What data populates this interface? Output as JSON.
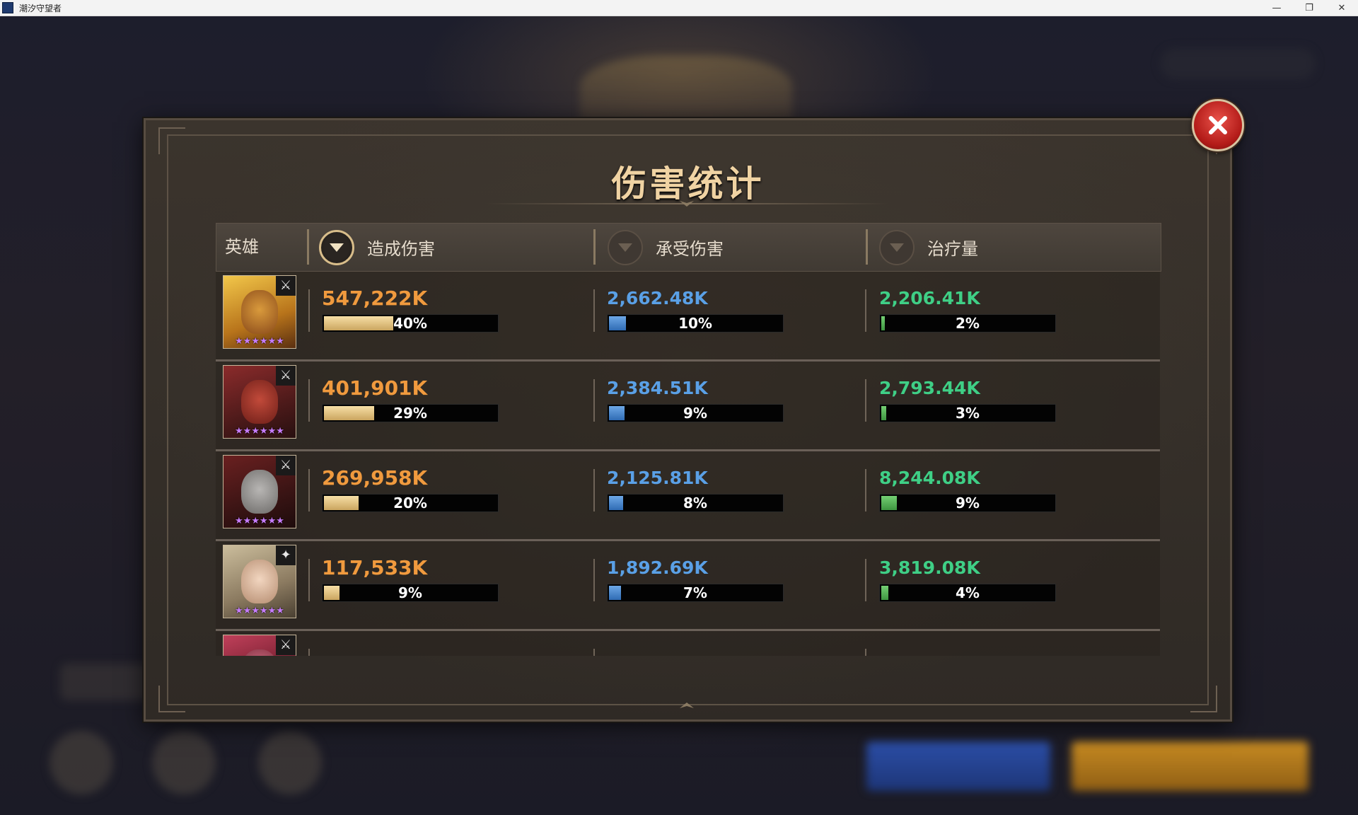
{
  "window": {
    "title": "潮汐守望者",
    "minimize_glyph": "—",
    "restore_glyph": "❐",
    "close_glyph": "✕"
  },
  "panel": {
    "title": "伤害统计"
  },
  "header": {
    "hero": "英雄",
    "columns": [
      {
        "label": "造成伤害",
        "sort_active": true
      },
      {
        "label": "承受伤害",
        "sort_active": false
      },
      {
        "label": "治疗量",
        "sort_active": false
      }
    ]
  },
  "colors": {
    "dealt": "#f09a3e",
    "taken": "#5aa0e6",
    "heal": "#3fcf86",
    "stars": "#c77dff"
  },
  "rows": [
    {
      "hero": "hero-1",
      "stars": "★★★★★★",
      "role_icon": "sword-icon",
      "role_glyph": "⚔",
      "dealt": "547,222K",
      "dealt_pct": "40%",
      "dealt_frac": 0.4,
      "taken": "2,662.48K",
      "taken_pct": "10%",
      "taken_frac": 0.1,
      "heal": "2,206.41K",
      "heal_pct": "2%",
      "heal_frac": 0.02
    },
    {
      "hero": "hero-2",
      "stars": "★★★★★★",
      "role_icon": "sword-icon",
      "role_glyph": "⚔",
      "dealt": "401,901K",
      "dealt_pct": "29%",
      "dealt_frac": 0.29,
      "taken": "2,384.51K",
      "taken_pct": "9%",
      "taken_frac": 0.09,
      "heal": "2,793.44K",
      "heal_pct": "3%",
      "heal_frac": 0.03
    },
    {
      "hero": "hero-3",
      "stars": "★★★★★★",
      "role_icon": "sword-icon",
      "role_glyph": "⚔",
      "dealt": "269,958K",
      "dealt_pct": "20%",
      "dealt_frac": 0.2,
      "taken": "2,125.81K",
      "taken_pct": "8%",
      "taken_frac": 0.08,
      "heal": "8,244.08K",
      "heal_pct": "9%",
      "heal_frac": 0.09
    },
    {
      "hero": "hero-4",
      "stars": "★★★★★★",
      "role_icon": "staff-icon",
      "role_glyph": "✦",
      "dealt": "117,533K",
      "dealt_pct": "9%",
      "dealt_frac": 0.09,
      "taken": "1,892.69K",
      "taken_pct": "7%",
      "taken_frac": 0.07,
      "heal": "3,819.08K",
      "heal_pct": "4%",
      "heal_frac": 0.04
    }
  ]
}
